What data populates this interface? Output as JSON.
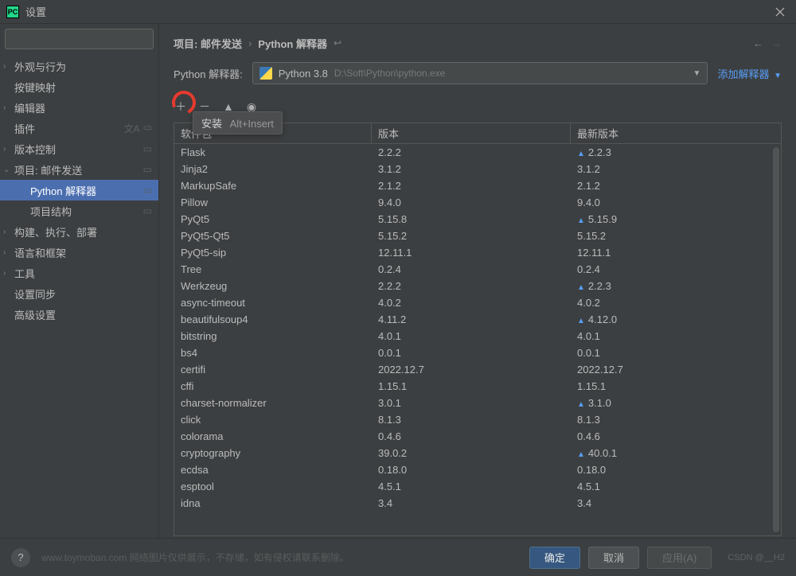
{
  "window": {
    "title": "设置",
    "close_aria": "Close"
  },
  "search": {
    "placeholder": ""
  },
  "sidebar": {
    "items": [
      {
        "label": "外观与行为",
        "expandable": true,
        "expanded": false,
        "level": 1
      },
      {
        "label": "按键映射",
        "expandable": false,
        "level": 1
      },
      {
        "label": "编辑器",
        "expandable": true,
        "expanded": false,
        "level": 1
      },
      {
        "label": "插件",
        "expandable": false,
        "level": 1,
        "lang_icon": true,
        "project_icon": true
      },
      {
        "label": "版本控制",
        "expandable": true,
        "expanded": false,
        "level": 1,
        "project_icon": true
      },
      {
        "label": "项目: 邮件发送",
        "expandable": true,
        "expanded": true,
        "level": 1,
        "project_icon": true
      },
      {
        "label": "Python 解释器",
        "expandable": false,
        "level": 2,
        "selected": true,
        "project_icon": true
      },
      {
        "label": "项目结构",
        "expandable": false,
        "level": 2,
        "project_icon": true
      },
      {
        "label": "构建、执行、部署",
        "expandable": true,
        "expanded": false,
        "level": 1
      },
      {
        "label": "语言和框架",
        "expandable": true,
        "expanded": false,
        "level": 1
      },
      {
        "label": "工具",
        "expandable": true,
        "expanded": false,
        "level": 1
      },
      {
        "label": "设置同步",
        "expandable": false,
        "level": 1
      },
      {
        "label": "高级设置",
        "expandable": false,
        "level": 1
      }
    ]
  },
  "breadcrumb": {
    "project": "项目: 邮件发送",
    "page": "Python 解释器"
  },
  "interpreter": {
    "label": "Python 解释器:",
    "name": "Python 3.8",
    "path": "D:\\Soft\\Python\\python.exe",
    "add_label": "添加解释器"
  },
  "tooltip": {
    "label": "安装",
    "shortcut": "Alt+Insert"
  },
  "table": {
    "headers": {
      "name": "软件包",
      "version": "版本",
      "latest": "最新版本"
    },
    "rows": [
      {
        "name": "Flask",
        "version": "2.2.2",
        "latest": "2.2.3",
        "update": true
      },
      {
        "name": "Jinja2",
        "version": "3.1.2",
        "latest": "3.1.2"
      },
      {
        "name": "MarkupSafe",
        "version": "2.1.2",
        "latest": "2.1.2"
      },
      {
        "name": "Pillow",
        "version": "9.4.0",
        "latest": "9.4.0"
      },
      {
        "name": "PyQt5",
        "version": "5.15.8",
        "latest": "5.15.9",
        "update": true
      },
      {
        "name": "PyQt5-Qt5",
        "version": "5.15.2",
        "latest": "5.15.2"
      },
      {
        "name": "PyQt5-sip",
        "version": "12.11.1",
        "latest": "12.11.1"
      },
      {
        "name": "Tree",
        "version": "0.2.4",
        "latest": "0.2.4"
      },
      {
        "name": "Werkzeug",
        "version": "2.2.2",
        "latest": "2.2.3",
        "update": true
      },
      {
        "name": "async-timeout",
        "version": "4.0.2",
        "latest": "4.0.2"
      },
      {
        "name": "beautifulsoup4",
        "version": "4.11.2",
        "latest": "4.12.0",
        "update": true
      },
      {
        "name": "bitstring",
        "version": "4.0.1",
        "latest": "4.0.1"
      },
      {
        "name": "bs4",
        "version": "0.0.1",
        "latest": "0.0.1"
      },
      {
        "name": "certifi",
        "version": "2022.12.7",
        "latest": "2022.12.7"
      },
      {
        "name": "cffi",
        "version": "1.15.1",
        "latest": "1.15.1"
      },
      {
        "name": "charset-normalizer",
        "version": "3.0.1",
        "latest": "3.1.0",
        "update": true
      },
      {
        "name": "click",
        "version": "8.1.3",
        "latest": "8.1.3"
      },
      {
        "name": "colorama",
        "version": "0.4.6",
        "latest": "0.4.6"
      },
      {
        "name": "cryptography",
        "version": "39.0.2",
        "latest": "40.0.1",
        "update": true
      },
      {
        "name": "ecdsa",
        "version": "0.18.0",
        "latest": "0.18.0"
      },
      {
        "name": "esptool",
        "version": "4.5.1",
        "latest": "4.5.1"
      },
      {
        "name": "idna",
        "version": "3.4",
        "latest": "3.4"
      }
    ]
  },
  "footer": {
    "ok": "确定",
    "cancel": "取消",
    "apply": "应用(A)",
    "watermark": "www.toymoban.com 网络图片仅供展示，不存储，如有侵权请联系删除。",
    "credits": "CSDN @__H2"
  }
}
